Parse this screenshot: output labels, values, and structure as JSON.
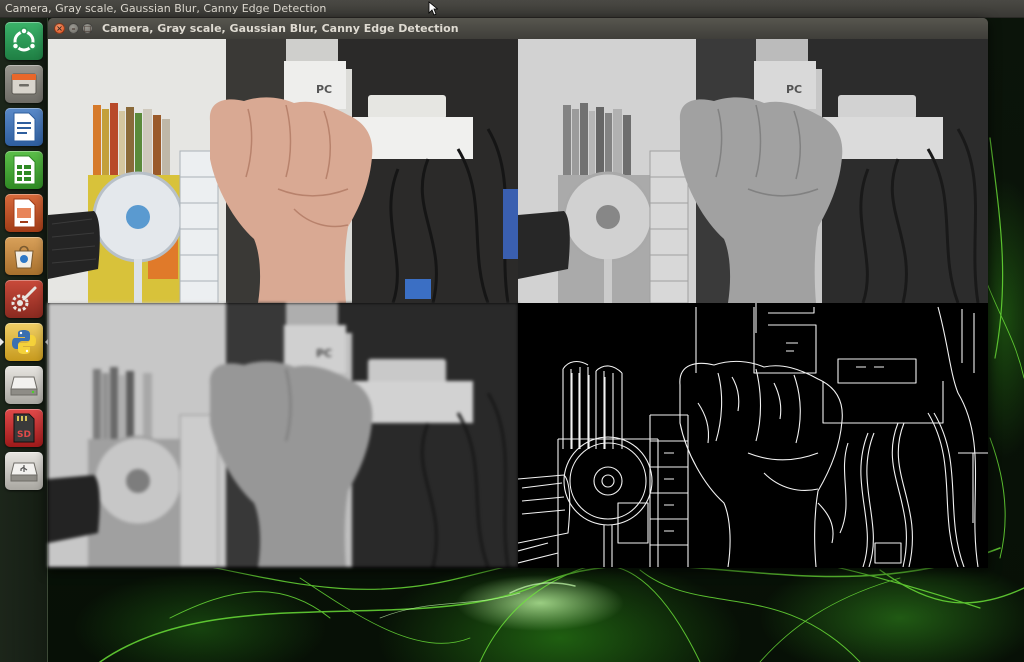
{
  "top_panel": {
    "title": "Camera, Gray scale, Gaussian Blur, Canny Edge Detection"
  },
  "window": {
    "title": "Camera, Gray scale, Gaussian Blur, Canny Edge Detection",
    "close_symbol": "×",
    "minimize_symbol": "–",
    "maximize_symbol": "□"
  },
  "launcher": {
    "items": [
      {
        "icon": "ubuntu-logo-icon"
      },
      {
        "icon": "file-manager-icon"
      },
      {
        "icon": "writer-document-icon"
      },
      {
        "icon": "calc-spreadsheet-icon"
      },
      {
        "icon": "impress-presentation-icon"
      },
      {
        "icon": "software-center-icon"
      },
      {
        "icon": "system-settings-icon"
      },
      {
        "icon": "python-icon",
        "active": true
      },
      {
        "icon": "drive-icon"
      },
      {
        "icon": "sd-card-icon",
        "label": "SD"
      },
      {
        "icon": "usb-drive-icon"
      }
    ]
  },
  "panes": [
    {
      "name": "camera",
      "color_mode": "color"
    },
    {
      "name": "gray-scale",
      "color_mode": "grayscale"
    },
    {
      "name": "gaussian-blur",
      "color_mode": "grayscale-blurred"
    },
    {
      "name": "canny-edge-detection",
      "color_mode": "edges-white-on-black"
    }
  ],
  "colors": {
    "panel_bg": "#3c3b37",
    "close_button": "#df4a16",
    "wallpaper_glow": "#5cd62e",
    "launcher_python": "#e8c23a"
  }
}
